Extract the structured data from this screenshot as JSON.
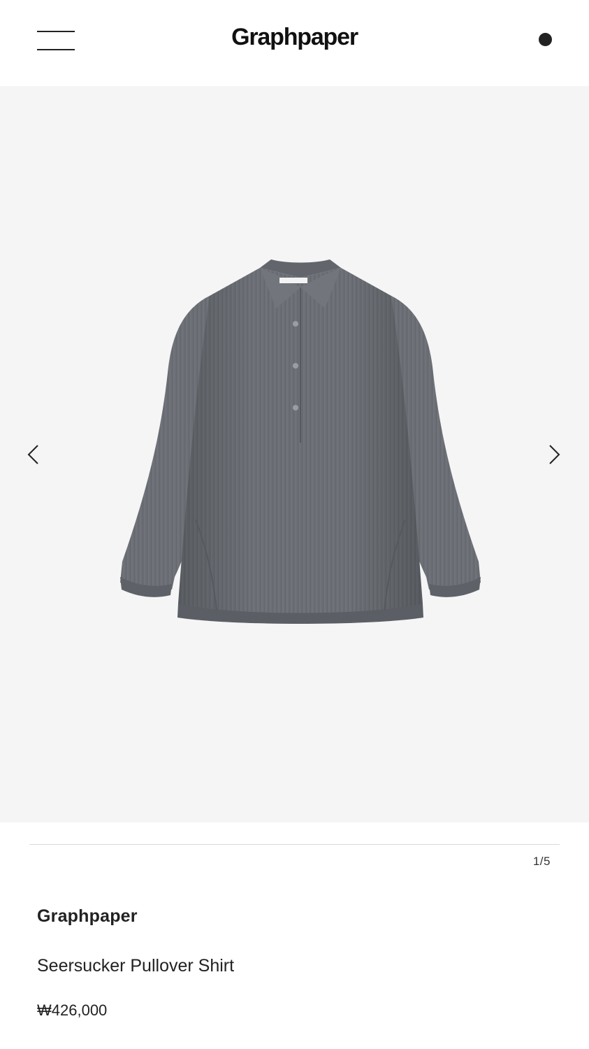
{
  "header": {
    "logo": "Graphpaper"
  },
  "gallery": {
    "counter_current": "1",
    "counter_separator": "/",
    "counter_total": "5",
    "background_color": "#f5f5f5"
  },
  "product": {
    "brand": "Graphpaper",
    "name": "Seersucker Pullover Shirt",
    "price": "₩426,000",
    "color": "#6b6f75"
  },
  "icons": {
    "menu": "hamburger-menu-icon",
    "account": "account-dot-icon",
    "prev": "chevron-left-icon",
    "next": "chevron-right-icon"
  }
}
